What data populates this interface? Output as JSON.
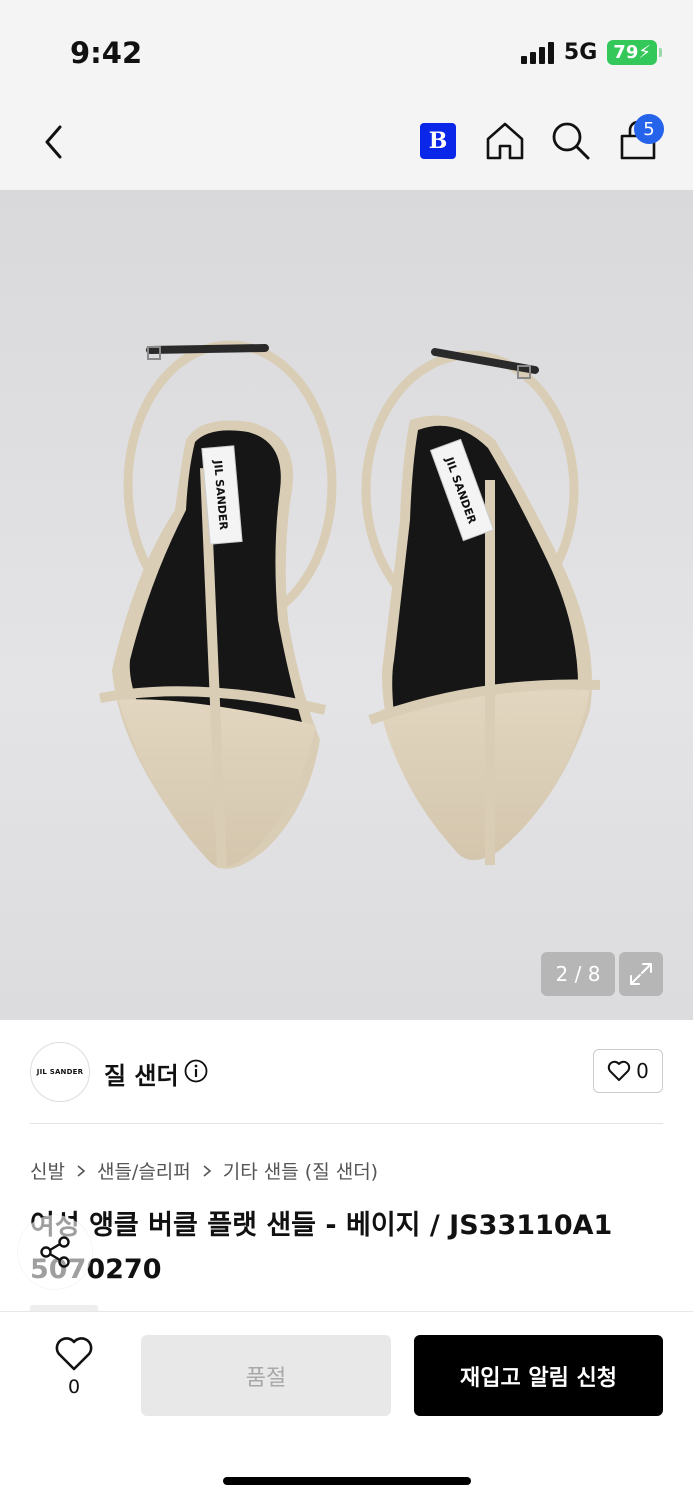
{
  "status_bar": {
    "time": "9:42",
    "network": "5G",
    "battery": "79"
  },
  "nav": {
    "brand_badge": "B",
    "cart_count": "5",
    "icons": [
      "chevron-left-icon",
      "brand-b-icon",
      "home-icon",
      "search-icon",
      "shopping-bag-icon"
    ]
  },
  "gallery": {
    "counter": "2 / 8",
    "insole_label": "JIL SANDER"
  },
  "brand": {
    "logo_text": "JIL SANDER",
    "name": "질 샌더",
    "like_count": "0"
  },
  "breadcrumb": [
    "신발",
    "샌들/슬리퍼",
    "기타 샌들 (질 샌더)"
  ],
  "product": {
    "title": "여성 앵클 버클 플랫 샌들 - 베이지 / JS33110A1 5070270"
  },
  "actions": {
    "wish_count": "0",
    "soldout_label": "품절",
    "restock_label": "재입고 알림 신청"
  },
  "colors": {
    "accent_blue": "#0a26e8",
    "cart_badge": "#2563eb",
    "battery_green": "#34c759",
    "primary_button": "#000000",
    "disabled_button": "#e8e8e8"
  }
}
